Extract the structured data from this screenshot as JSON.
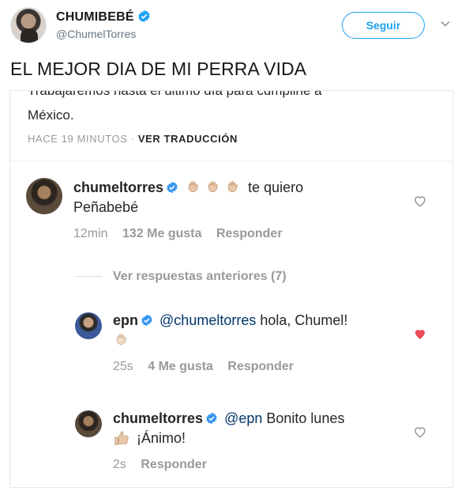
{
  "tweet": {
    "display_name": "CHUMIBEBÉ",
    "handle": "@ChumelTorres",
    "follow_label": "Seguir",
    "text": "EL MEJOR DIA DE MI PERRA VIDA"
  },
  "embedded": {
    "cutoff_text": "Trabajaremos hasta el último día para cumplirle a",
    "mexico_text": "México.",
    "time_ago": "HACE 19 MINUTOS",
    "separator": "·",
    "translate_label": "VER TRADUCCIÓN",
    "view_previous": "Ver respuestas anteriores (7)",
    "comments": [
      {
        "username": "chumeltorres",
        "text_line1": "te quiero",
        "text_line2": "Peñabebé",
        "time": "12min",
        "likes": "132 Me gusta",
        "reply": "Responder",
        "liked": false
      },
      {
        "username": "epn",
        "mention": "@chumeltorres",
        "text_line1": "hola, Chumel!",
        "time": "25s",
        "likes": "4 Me gusta",
        "reply": "Responder",
        "liked": true
      },
      {
        "username": "chumeltorres",
        "mention": "@epn",
        "text_line1": "Bonito lunes",
        "text_line2": "¡Ánimo!",
        "time": "2s",
        "reply": "Responder",
        "liked": false
      }
    ]
  },
  "icons": [
    "verified-badge-icon",
    "chevron-down-icon",
    "heart-outline-icon",
    "heart-filled-icon",
    "waving-hand-emoji-icon",
    "thumbs-up-emoji-icon"
  ],
  "colors": {
    "twitter_blue": "#1da1f2",
    "instagram_text": "#262626",
    "muted": "#999999",
    "mention": "#003569",
    "heart_red": "#ed4956"
  }
}
